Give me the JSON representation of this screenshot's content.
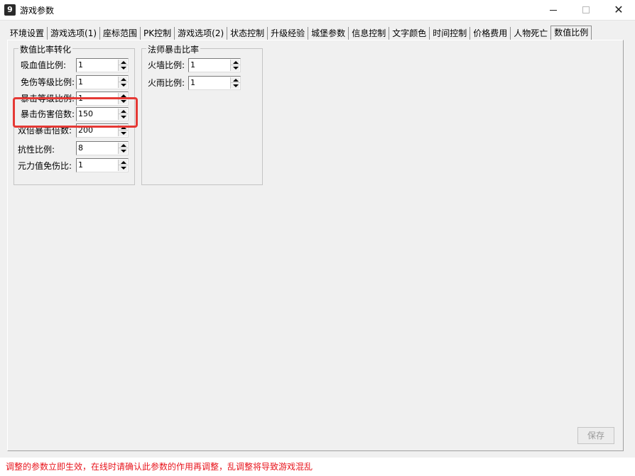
{
  "window": {
    "app_icon": "9",
    "title": "游戏参数",
    "minimize_icon": "minimize-icon",
    "maximize_icon": "maximize-icon",
    "close_icon": "close-icon"
  },
  "tabs": [
    "环境设置",
    "游戏选项(1)",
    "座标范围",
    "PK控制",
    "游戏选项(2)",
    "状态控制",
    "升级经验",
    "城堡参数",
    "信息控制",
    "文字颜色",
    "时间控制",
    "价格费用",
    "人物死亡",
    "数值比例"
  ],
  "active_tab": "数值比例",
  "group_ratio": {
    "title": "数值比率转化",
    "fields": [
      {
        "label": "吸血值比例:",
        "value": "1"
      },
      {
        "label": "免伤等级比例:",
        "value": "1"
      },
      {
        "label": "暴击等级比例:",
        "value": "1"
      },
      {
        "label": "暴击伤害倍数:",
        "value": "150"
      },
      {
        "label": "双倍暴击倍数:",
        "value": "200"
      },
      {
        "label": "抗性比例:",
        "value": "8"
      },
      {
        "label": "元力值免伤比:",
        "value": "1"
      }
    ]
  },
  "group_mage": {
    "title": "法师暴击比率",
    "fields": [
      {
        "label": "火墙比例:",
        "value": "1"
      },
      {
        "label": "火雨比例:",
        "value": "1"
      }
    ]
  },
  "save_label": "保存",
  "status_text": "调整的参数立即生效，在线时请确认此参数的作用再调整，乱调整将导致游戏混乱",
  "colors": {
    "highlight": "#e53935",
    "status_text": "#e8141c"
  }
}
